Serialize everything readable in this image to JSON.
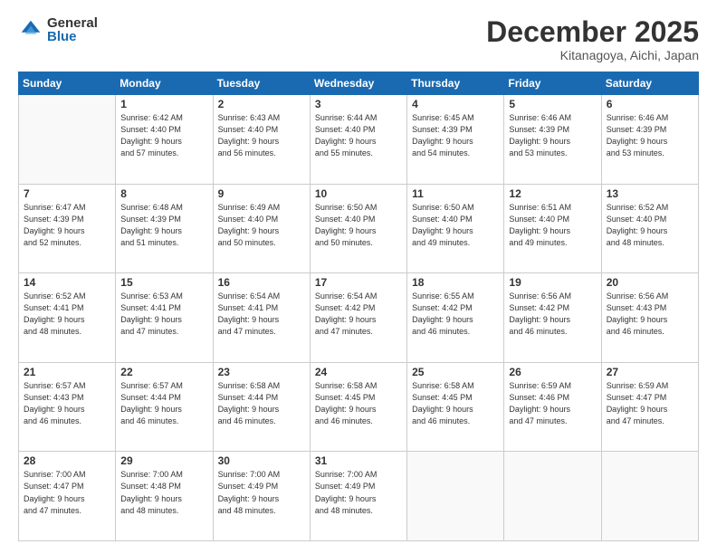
{
  "logo": {
    "general": "General",
    "blue": "Blue"
  },
  "title": "December 2025",
  "location": "Kitanagoya, Aichi, Japan",
  "headers": [
    "Sunday",
    "Monday",
    "Tuesday",
    "Wednesday",
    "Thursday",
    "Friday",
    "Saturday"
  ],
  "weeks": [
    [
      {
        "day": "",
        "info": ""
      },
      {
        "day": "1",
        "info": "Sunrise: 6:42 AM\nSunset: 4:40 PM\nDaylight: 9 hours\nand 57 minutes."
      },
      {
        "day": "2",
        "info": "Sunrise: 6:43 AM\nSunset: 4:40 PM\nDaylight: 9 hours\nand 56 minutes."
      },
      {
        "day": "3",
        "info": "Sunrise: 6:44 AM\nSunset: 4:40 PM\nDaylight: 9 hours\nand 55 minutes."
      },
      {
        "day": "4",
        "info": "Sunrise: 6:45 AM\nSunset: 4:39 PM\nDaylight: 9 hours\nand 54 minutes."
      },
      {
        "day": "5",
        "info": "Sunrise: 6:46 AM\nSunset: 4:39 PM\nDaylight: 9 hours\nand 53 minutes."
      },
      {
        "day": "6",
        "info": "Sunrise: 6:46 AM\nSunset: 4:39 PM\nDaylight: 9 hours\nand 53 minutes."
      }
    ],
    [
      {
        "day": "7",
        "info": "Sunrise: 6:47 AM\nSunset: 4:39 PM\nDaylight: 9 hours\nand 52 minutes."
      },
      {
        "day": "8",
        "info": "Sunrise: 6:48 AM\nSunset: 4:39 PM\nDaylight: 9 hours\nand 51 minutes."
      },
      {
        "day": "9",
        "info": "Sunrise: 6:49 AM\nSunset: 4:40 PM\nDaylight: 9 hours\nand 50 minutes."
      },
      {
        "day": "10",
        "info": "Sunrise: 6:50 AM\nSunset: 4:40 PM\nDaylight: 9 hours\nand 50 minutes."
      },
      {
        "day": "11",
        "info": "Sunrise: 6:50 AM\nSunset: 4:40 PM\nDaylight: 9 hours\nand 49 minutes."
      },
      {
        "day": "12",
        "info": "Sunrise: 6:51 AM\nSunset: 4:40 PM\nDaylight: 9 hours\nand 49 minutes."
      },
      {
        "day": "13",
        "info": "Sunrise: 6:52 AM\nSunset: 4:40 PM\nDaylight: 9 hours\nand 48 minutes."
      }
    ],
    [
      {
        "day": "14",
        "info": "Sunrise: 6:52 AM\nSunset: 4:41 PM\nDaylight: 9 hours\nand 48 minutes."
      },
      {
        "day": "15",
        "info": "Sunrise: 6:53 AM\nSunset: 4:41 PM\nDaylight: 9 hours\nand 47 minutes."
      },
      {
        "day": "16",
        "info": "Sunrise: 6:54 AM\nSunset: 4:41 PM\nDaylight: 9 hours\nand 47 minutes."
      },
      {
        "day": "17",
        "info": "Sunrise: 6:54 AM\nSunset: 4:42 PM\nDaylight: 9 hours\nand 47 minutes."
      },
      {
        "day": "18",
        "info": "Sunrise: 6:55 AM\nSunset: 4:42 PM\nDaylight: 9 hours\nand 46 minutes."
      },
      {
        "day": "19",
        "info": "Sunrise: 6:56 AM\nSunset: 4:42 PM\nDaylight: 9 hours\nand 46 minutes."
      },
      {
        "day": "20",
        "info": "Sunrise: 6:56 AM\nSunset: 4:43 PM\nDaylight: 9 hours\nand 46 minutes."
      }
    ],
    [
      {
        "day": "21",
        "info": "Sunrise: 6:57 AM\nSunset: 4:43 PM\nDaylight: 9 hours\nand 46 minutes."
      },
      {
        "day": "22",
        "info": "Sunrise: 6:57 AM\nSunset: 4:44 PM\nDaylight: 9 hours\nand 46 minutes."
      },
      {
        "day": "23",
        "info": "Sunrise: 6:58 AM\nSunset: 4:44 PM\nDaylight: 9 hours\nand 46 minutes."
      },
      {
        "day": "24",
        "info": "Sunrise: 6:58 AM\nSunset: 4:45 PM\nDaylight: 9 hours\nand 46 minutes."
      },
      {
        "day": "25",
        "info": "Sunrise: 6:58 AM\nSunset: 4:45 PM\nDaylight: 9 hours\nand 46 minutes."
      },
      {
        "day": "26",
        "info": "Sunrise: 6:59 AM\nSunset: 4:46 PM\nDaylight: 9 hours\nand 47 minutes."
      },
      {
        "day": "27",
        "info": "Sunrise: 6:59 AM\nSunset: 4:47 PM\nDaylight: 9 hours\nand 47 minutes."
      }
    ],
    [
      {
        "day": "28",
        "info": "Sunrise: 7:00 AM\nSunset: 4:47 PM\nDaylight: 9 hours\nand 47 minutes."
      },
      {
        "day": "29",
        "info": "Sunrise: 7:00 AM\nSunset: 4:48 PM\nDaylight: 9 hours\nand 48 minutes."
      },
      {
        "day": "30",
        "info": "Sunrise: 7:00 AM\nSunset: 4:49 PM\nDaylight: 9 hours\nand 48 minutes."
      },
      {
        "day": "31",
        "info": "Sunrise: 7:00 AM\nSunset: 4:49 PM\nDaylight: 9 hours\nand 48 minutes."
      },
      {
        "day": "",
        "info": ""
      },
      {
        "day": "",
        "info": ""
      },
      {
        "day": "",
        "info": ""
      }
    ]
  ]
}
